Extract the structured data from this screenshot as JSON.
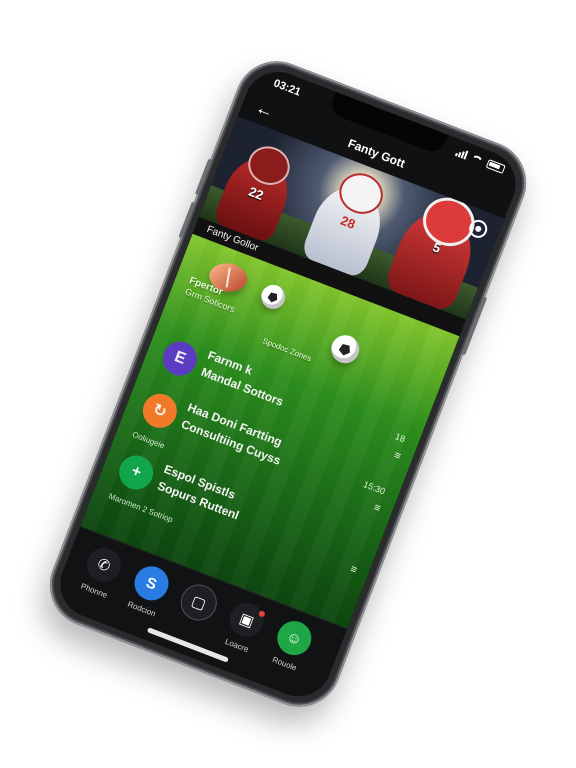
{
  "status_bar": {
    "time": "03:21"
  },
  "app_bar": {
    "title": "Fanty Gott"
  },
  "hero": {
    "numbers": [
      "22",
      "28",
      "5"
    ]
  },
  "section": {
    "label": "Fanty Gollor"
  },
  "promo": {
    "title": "Fpertor",
    "subtitle": "Grm Soticors",
    "tag": "Spodoc Zones"
  },
  "items": [
    {
      "avatar": "E",
      "title": "Farnm k",
      "sub": "Mandal Sottors",
      "meta": "18",
      "menu": "≡"
    },
    {
      "avatar": "↻",
      "title": "Haa Doni Fartting",
      "sub": "Consultiing Cuyss",
      "meta": "15:30",
      "menu": "≡"
    },
    {
      "avatar": "+",
      "title": "Espol Spistls",
      "sub": "Sopurs Ruttenl",
      "meta": "",
      "menu": "≡"
    }
  ],
  "captions": {
    "item2_pre": "Ooliugeie",
    "footer": "Maromen 2 Sotriop"
  },
  "bottom_nav": [
    {
      "label": "Phonne",
      "icon": "phone-icon",
      "glyph": "✆"
    },
    {
      "label": "Rodcion",
      "icon": "s-app-icon",
      "glyph": "S"
    },
    {
      "label": "",
      "icon": "square-icon",
      "glyph": "▢"
    },
    {
      "label": "Loacre",
      "icon": "calendar-icon",
      "glyph": "▣"
    },
    {
      "label": "Rouole",
      "icon": "profile-icon",
      "glyph": "☺"
    }
  ],
  "colors": {
    "accent_green": "#1fa746",
    "accent_blue": "#2a7ce2",
    "accent_orange": "#f17a28",
    "accent_purple": "#5c3cc2"
  }
}
